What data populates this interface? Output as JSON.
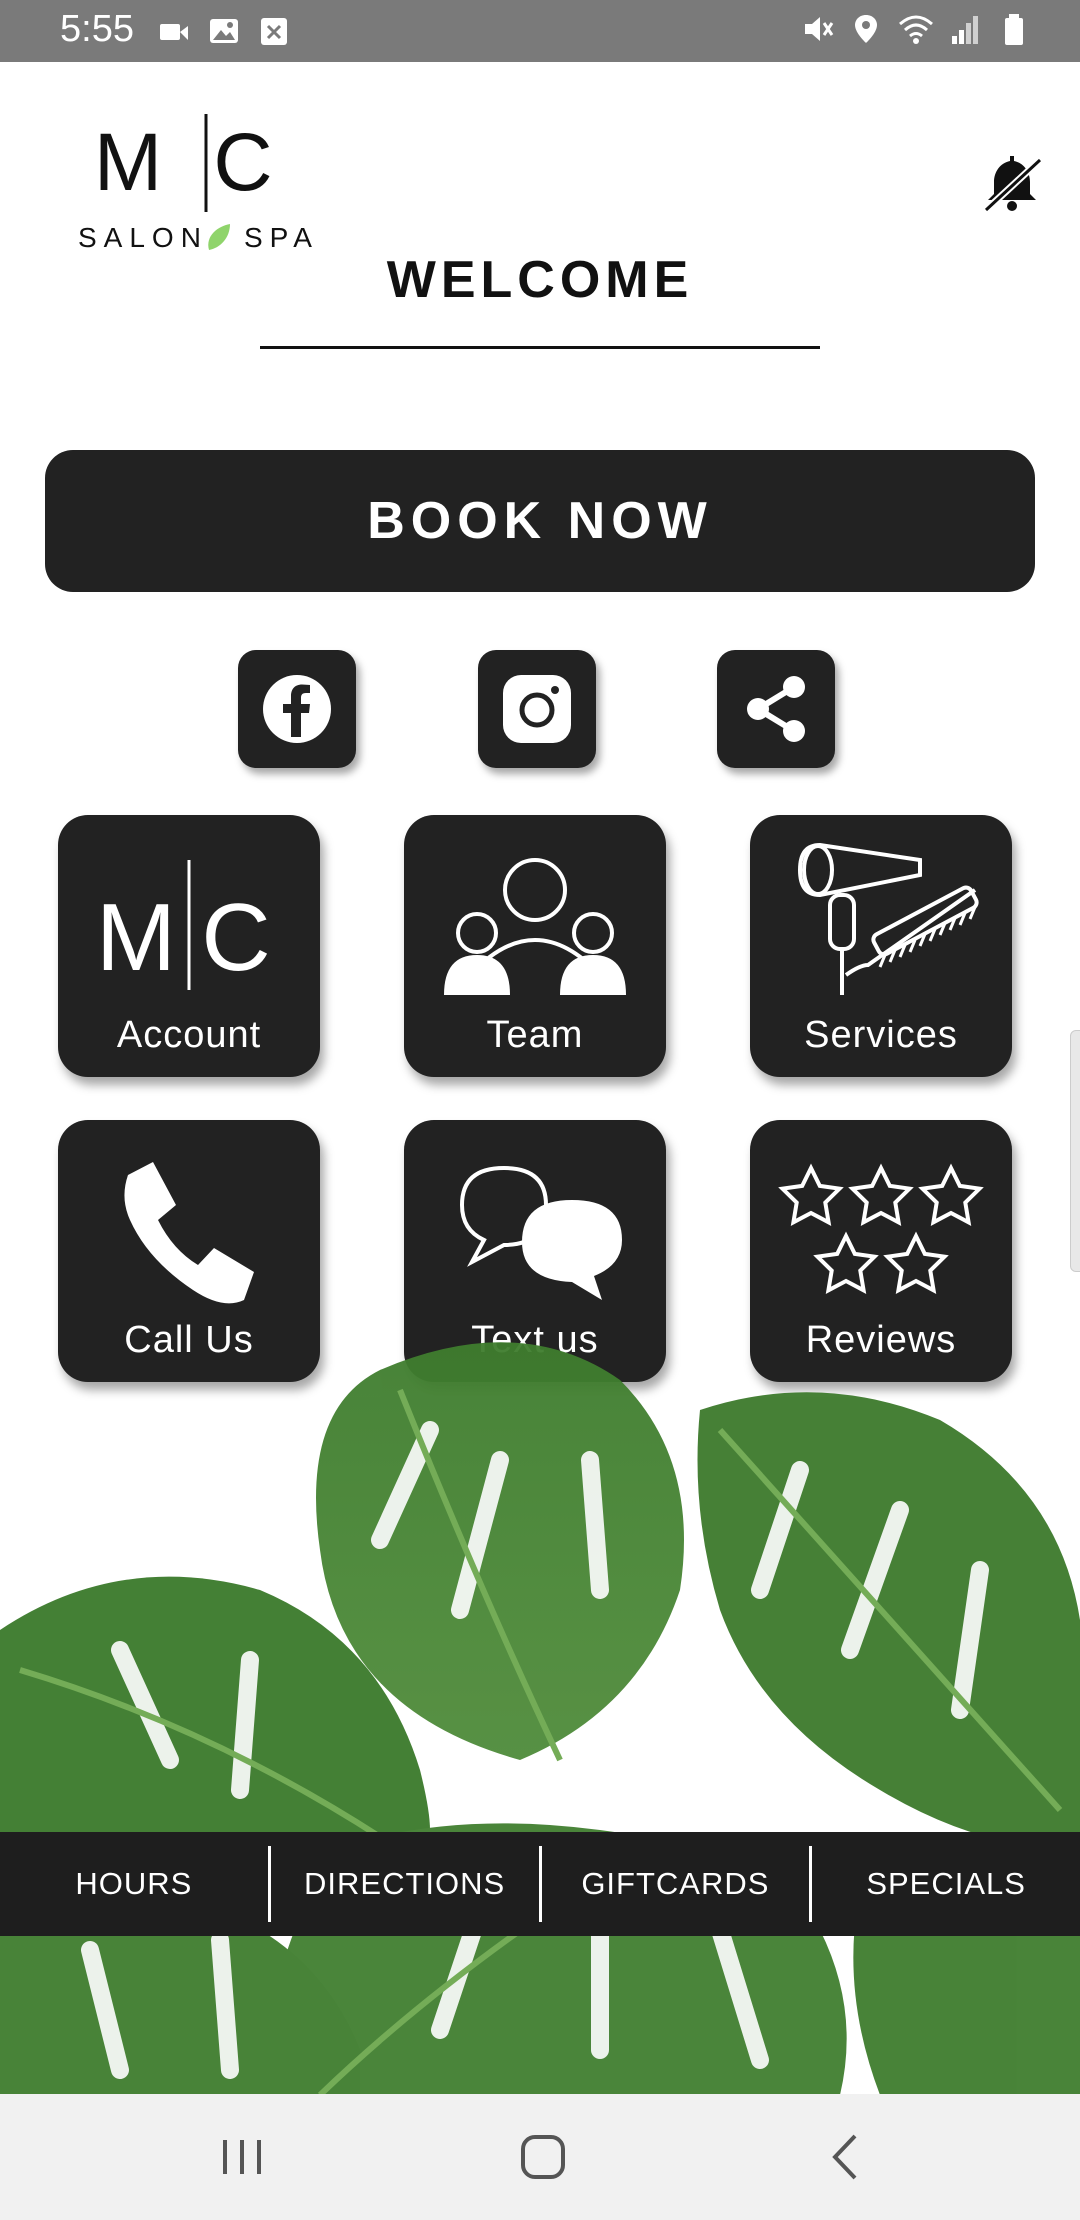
{
  "status_bar": {
    "time": "5:55"
  },
  "logo": {
    "monogram_left": "M",
    "monogram_right": "C",
    "subtitle_left": "SALON",
    "subtitle_right": "SPA"
  },
  "header": {
    "title": "WELCOME"
  },
  "book_now": {
    "label": "BOOK NOW"
  },
  "tiles": [
    {
      "label": "Account"
    },
    {
      "label": "Team"
    },
    {
      "label": "Services"
    },
    {
      "label": "Call Us"
    },
    {
      "label": "Text us"
    },
    {
      "label": "Reviews"
    }
  ],
  "bottom_bar": {
    "items": [
      "HOURS",
      "DIRECTIONS",
      "GIFTCARDS",
      "SPECIALS"
    ]
  },
  "colors": {
    "tile_bg": "#222222",
    "bottom_bar_bg": "#1e1e1e",
    "status_bar_bg": "#7a7a7a",
    "leaf_green": "#3f7d2e",
    "logo_leaf": "#8fd46b"
  },
  "icons": [
    "video-icon",
    "gallery-icon",
    "close-box-icon",
    "mute-icon",
    "location-icon",
    "wifi-icon",
    "signal-icon",
    "battery-icon",
    "bell-off-icon",
    "facebook-icon",
    "instagram-icon",
    "share-icon",
    "monogram-icon",
    "team-icon",
    "hair-dryer-icon",
    "phone-icon",
    "chat-icon",
    "stars-icon",
    "recents-icon",
    "home-icon",
    "back-icon"
  ]
}
